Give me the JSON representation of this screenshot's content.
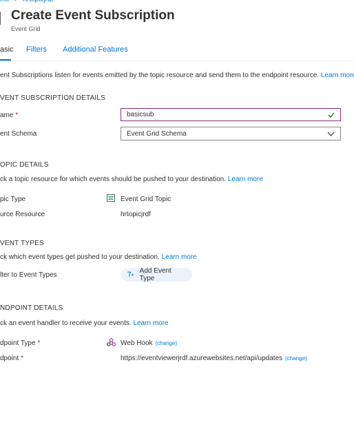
{
  "breadcrumb": {
    "items": [
      "me",
      "hrtopicjrdf"
    ],
    "separator": ">"
  },
  "header": {
    "title": "Create Event Subscription",
    "subtitle": "Event Grid"
  },
  "tabs": [
    {
      "label": "asic",
      "active": true
    },
    {
      "label": "Filters",
      "active": false
    },
    {
      "label": "Additional Features",
      "active": false
    }
  ],
  "intro": {
    "text": "ent Subscriptions listen for events emitted by the topic resource and send them to the endpoint resource.",
    "link": "Learn more"
  },
  "subscription_details": {
    "heading": "VENT SUBSCRIPTION DETAILS",
    "name_label": "ame",
    "name_value": "basicsub",
    "schema_label": "ent Schema",
    "schema_value": "Event Grid Schema"
  },
  "topic_details": {
    "heading": "OPIC DETAILS",
    "desc": "ck a topic resource for which events should be pushed to your destination.",
    "link": "Learn more",
    "type_label": "pic Type",
    "type_value": "Event Grid Topic",
    "resource_label": "urce Resource",
    "resource_value": "hrtopicjrdf"
  },
  "event_types": {
    "heading": "VENT TYPES",
    "desc": "ck which event types get pushed to your destination.",
    "link": "Learn more",
    "filter_label": "lter to Event Types",
    "add_button": "Add Event Type"
  },
  "endpoint_details": {
    "heading": "NDPOINT DETAILS",
    "desc": "ck an event handler to receive your events.",
    "link": "Learn more",
    "type_label": "dpoint Type",
    "type_value": "Web Hook",
    "type_change": "(change)",
    "endpoint_label": "dpoint",
    "endpoint_value": "https://eventviewerjrdf.azurewebsites.net/api/updates",
    "endpoint_change": "(change)"
  },
  "required_marker": "*",
  "colors": {
    "accent": "#0078d4",
    "focus_border": "#8a2b78",
    "valid_check": "#107c10",
    "required": "#a4262c"
  }
}
